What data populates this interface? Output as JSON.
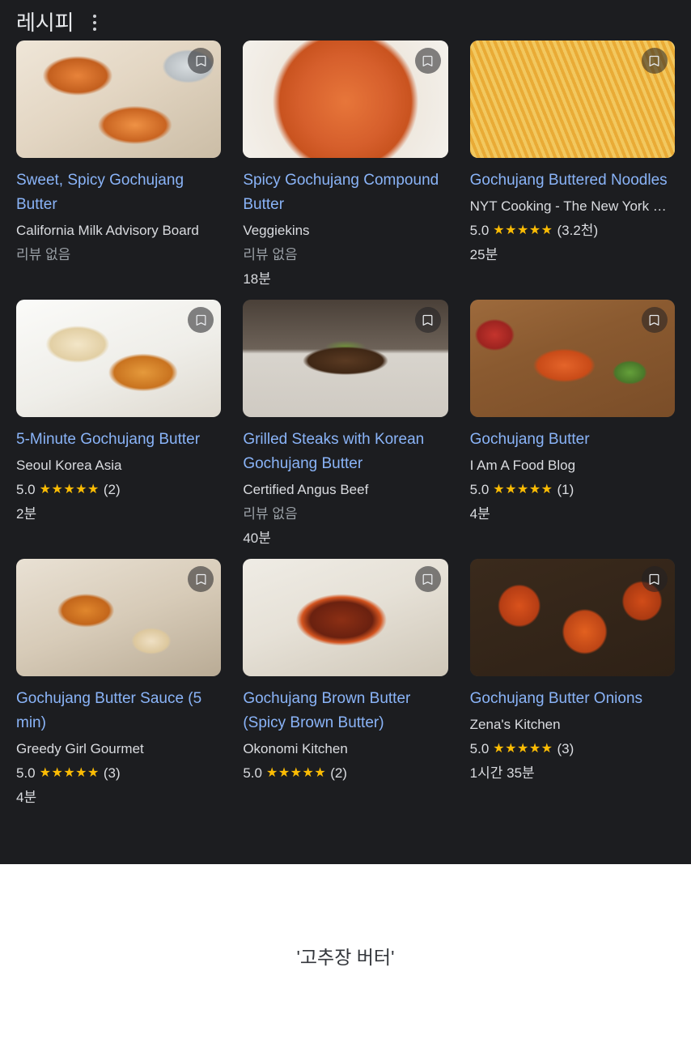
{
  "panel": {
    "title": "레시피",
    "menu_icon": "kebab-menu-icon",
    "bookmark_icon": "bookmark-icon"
  },
  "caption": "'고추장 버터'",
  "colors": {
    "panel_background": "#1c1d20",
    "title_link": "#8ab4f8",
    "body_text": "#dadce0",
    "muted_text": "#9aa0a6",
    "star": "#fbbc04",
    "page_background": "#ffffff"
  },
  "cards": [
    {
      "title": "Sweet, Spicy Gochujang Butter",
      "source": "California Milk Advisory Board",
      "rating_value": "",
      "stars": "",
      "rating_count": "",
      "no_review": "리뷰 없음",
      "time": "",
      "photo": "ph1"
    },
    {
      "title": "Spicy Gochujang Compound Butter",
      "source": "Veggiekins",
      "rating_value": "",
      "stars": "",
      "rating_count": "",
      "no_review": "리뷰 없음",
      "time": "18분",
      "photo": "ph2"
    },
    {
      "title": "Gochujang Buttered Noodles",
      "source": "NYT Cooking - The New York …",
      "rating_value": "5.0",
      "stars": "★★★★★",
      "rating_count": "(3.2천)",
      "no_review": "",
      "time": "25분",
      "photo": "ph3"
    },
    {
      "title": "5-Minute Gochujang Butter",
      "source": "Seoul Korea Asia",
      "rating_value": "5.0",
      "stars": "★★★★★",
      "rating_count": "(2)",
      "no_review": "",
      "time": "2분",
      "photo": "ph4"
    },
    {
      "title": "Grilled Steaks with Korean Gochujang Butter",
      "source": "Certified Angus Beef",
      "rating_value": "",
      "stars": "",
      "rating_count": "",
      "no_review": "리뷰 없음",
      "time": "40분",
      "photo": "ph5"
    },
    {
      "title": "Gochujang Butter",
      "source": "I Am A Food Blog",
      "rating_value": "5.0",
      "stars": "★★★★★",
      "rating_count": "(1)",
      "no_review": "",
      "time": "4분",
      "photo": "ph6"
    },
    {
      "title": "Gochujang Butter Sauce (5 min)",
      "source": "Greedy Girl Gourmet",
      "rating_value": "5.0",
      "stars": "★★★★★",
      "rating_count": "(3)",
      "no_review": "",
      "time": "4분",
      "photo": "ph7"
    },
    {
      "title": "Gochujang Brown Butter (Spicy Brown Butter)",
      "source": "Okonomi Kitchen",
      "rating_value": "5.0",
      "stars": "★★★★★",
      "rating_count": "(2)",
      "no_review": "",
      "time": "",
      "photo": "ph8"
    },
    {
      "title": "Gochujang Butter Onions",
      "source": "Zena's Kitchen",
      "rating_value": "5.0",
      "stars": "★★★★★",
      "rating_count": "(3)",
      "no_review": "",
      "time": "1시간 35분",
      "photo": "ph9"
    }
  ]
}
